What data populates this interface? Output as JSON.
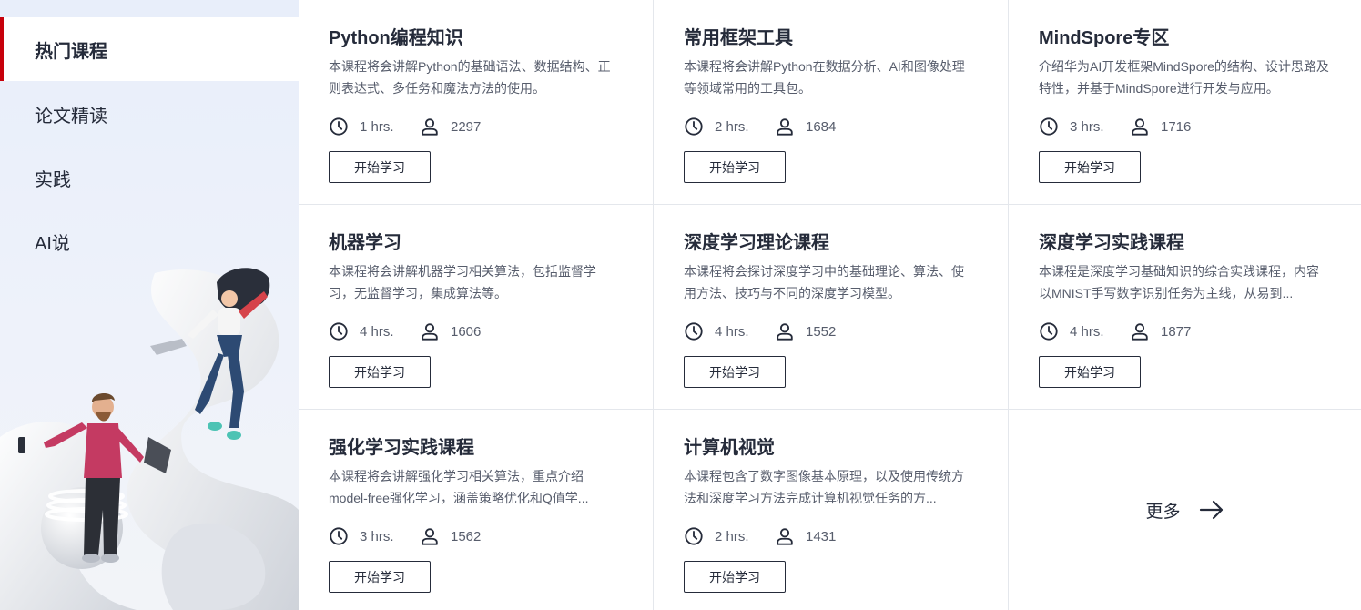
{
  "sidebar": {
    "items": [
      {
        "label": "热门课程",
        "active": true
      },
      {
        "label": "论文精读",
        "active": false
      },
      {
        "label": "实践",
        "active": false
      },
      {
        "label": "AI说",
        "active": false
      }
    ]
  },
  "courses": [
    {
      "title": "Python编程知识",
      "desc": "本课程将会讲解Python的基础语法、数据结构、正则表达式、多任务和魔法方法的使用。",
      "duration": "1 hrs.",
      "learners": "2297",
      "button": "开始学习"
    },
    {
      "title": "常用框架工具",
      "desc": "本课程将会讲解Python在数据分析、AI和图像处理等领域常用的工具包。",
      "duration": "2 hrs.",
      "learners": "1684",
      "button": "开始学习"
    },
    {
      "title": "MindSpore专区",
      "desc": "介绍华为AI开发框架MindSpore的结构、设计思路及特性，并基于MindSpore进行开发与应用。",
      "duration": "3 hrs.",
      "learners": "1716",
      "button": "开始学习"
    },
    {
      "title": "机器学习",
      "desc": "本课程将会讲解机器学习相关算法，包括监督学习，无监督学习，集成算法等。",
      "duration": "4 hrs.",
      "learners": "1606",
      "button": "开始学习"
    },
    {
      "title": "深度学习理论课程",
      "desc": "本课程将会探讨深度学习中的基础理论、算法、使用方法、技巧与不同的深度学习模型。",
      "duration": "4 hrs.",
      "learners": "1552",
      "button": "开始学习"
    },
    {
      "title": "深度学习实践课程",
      "desc": "本课程是深度学习基础知识的综合实践课程，内容以MNIST手写数字识别任务为主线，从易到...",
      "duration": "4 hrs.",
      "learners": "1877",
      "button": "开始学习"
    },
    {
      "title": "强化学习实践课程",
      "desc": "本课程将会讲解强化学习相关算法，重点介绍model-free强化学习，涵盖策略优化和Q值学...",
      "duration": "3 hrs.",
      "learners": "1562",
      "button": "开始学习"
    },
    {
      "title": "计算机视觉",
      "desc": "本课程包含了数字图像基本原理，以及使用传统方法和深度学习方法完成计算机视觉任务的方...",
      "duration": "2 hrs.",
      "learners": "1431",
      "button": "开始学习"
    }
  ],
  "more": {
    "label": "更多",
    "icon": "arrow-right-icon"
  },
  "icons": {
    "duration": "clock-icon",
    "learners": "user-icon"
  },
  "colors": {
    "accent": "#c7000b",
    "text": "#252b3a",
    "muted": "#575d6c",
    "sidebar_bg": "#e8eefa",
    "border": "#e4e7ec"
  }
}
